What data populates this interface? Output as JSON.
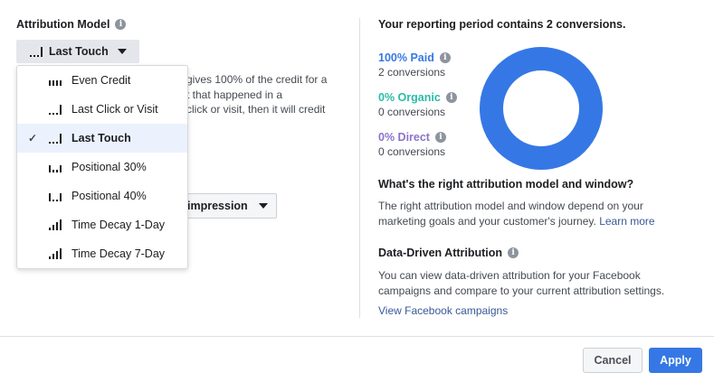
{
  "left": {
    "heading": "Attribution Model",
    "model_button_label": "Last Touch",
    "description_lines": [
      "gives 100% of the credit for a",
      "t that happened in a",
      "click or visit, then it will credit"
    ],
    "window_button_label": "impression"
  },
  "menu": {
    "items": [
      {
        "label": "Even Credit",
        "icon": "even-credit-bars-icon",
        "selected": false
      },
      {
        "label": "Last Click or Visit",
        "icon": "last-click-bars-icon",
        "selected": false
      },
      {
        "label": "Last Touch",
        "icon": "last-touch-bars-icon",
        "selected": true
      },
      {
        "label": "Positional 30%",
        "icon": "positional-bars-icon",
        "selected": false
      },
      {
        "label": "Positional 40%",
        "icon": "positional-bars-icon",
        "selected": false
      },
      {
        "label": "Time Decay 1-Day",
        "icon": "time-decay-bars-icon",
        "selected": false
      },
      {
        "label": "Time Decay 7-Day",
        "icon": "time-decay-bars-icon",
        "selected": false
      }
    ]
  },
  "right": {
    "title": "Your reporting period contains 2 conversions.",
    "stats": [
      {
        "name": "100% Paid",
        "sub": "2 conversions",
        "color": "#3578e5",
        "fraction": 1.0
      },
      {
        "name": "0% Organic",
        "sub": "0 conversions",
        "color": "#2abba7",
        "fraction": 0.0
      },
      {
        "name": "0% Direct",
        "sub": "0 conversions",
        "color": "#8c72cb",
        "fraction": 0.0
      }
    ],
    "section1_title": "What's the right attribution model and window?",
    "section1_line1": "The right attribution model and window depend on your",
    "section1_line2": "marketing goals and your customer's journey.",
    "section1_link": "Learn more",
    "section2_title": "Data-Driven Attribution",
    "section2_line1": "You can view data-driven attribution for your Facebook",
    "section2_line2": "campaigns and compare to your current attribution settings.",
    "section2_link": "View Facebook campaigns"
  },
  "footer": {
    "cancel_label": "Cancel",
    "apply_label": "Apply"
  },
  "colors": {
    "accent": "#3578e5",
    "organic": "#2abba7",
    "direct": "#8c72cb"
  }
}
